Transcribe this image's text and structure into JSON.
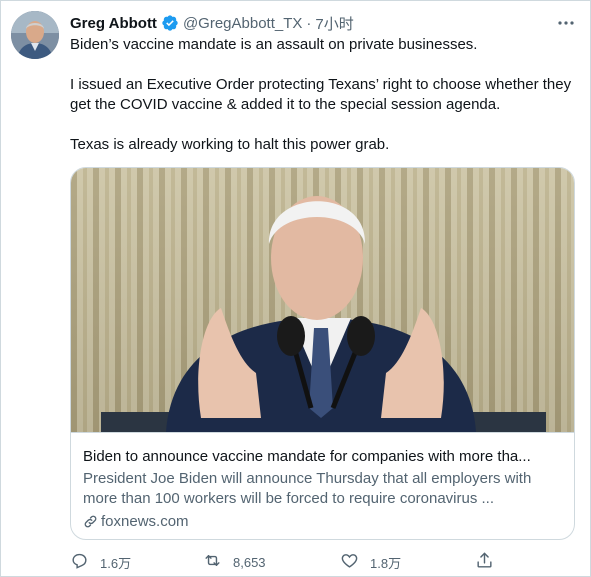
{
  "author": {
    "name": "Greg Abbott",
    "handle": "@GregAbbott_TX",
    "separator": "·",
    "time": "7小时"
  },
  "tweet": {
    "line1": "Biden’s vaccine mandate is an assault on private businesses.",
    "line2": "I issued an Executive Order protecting Texans’ right to choose whether they get the COVID vaccine & added it to the special session agenda.",
    "line3": "Texas is already working to halt this power grab."
  },
  "card": {
    "title": "Biden to announce vaccine mandate for companies with more tha...",
    "description": "President Joe Biden will announce Thursday that all employers with more than 100 workers will be forced to require coronavirus ...",
    "domain": "foxnews.com"
  },
  "actions": {
    "replies": "1.6万",
    "retweets": "8,653",
    "likes": "1.8万"
  },
  "icons": {
    "verified": "verified-badge-icon",
    "more": "more-options-icon",
    "link": "link-icon",
    "reply": "reply-icon",
    "retweet": "retweet-icon",
    "like": "heart-icon",
    "share": "share-icon"
  },
  "colors": {
    "verified": "#1d9bf0",
    "secondary_text": "#536471",
    "primary_text": "#0f1419",
    "border": "#cfd9de"
  }
}
